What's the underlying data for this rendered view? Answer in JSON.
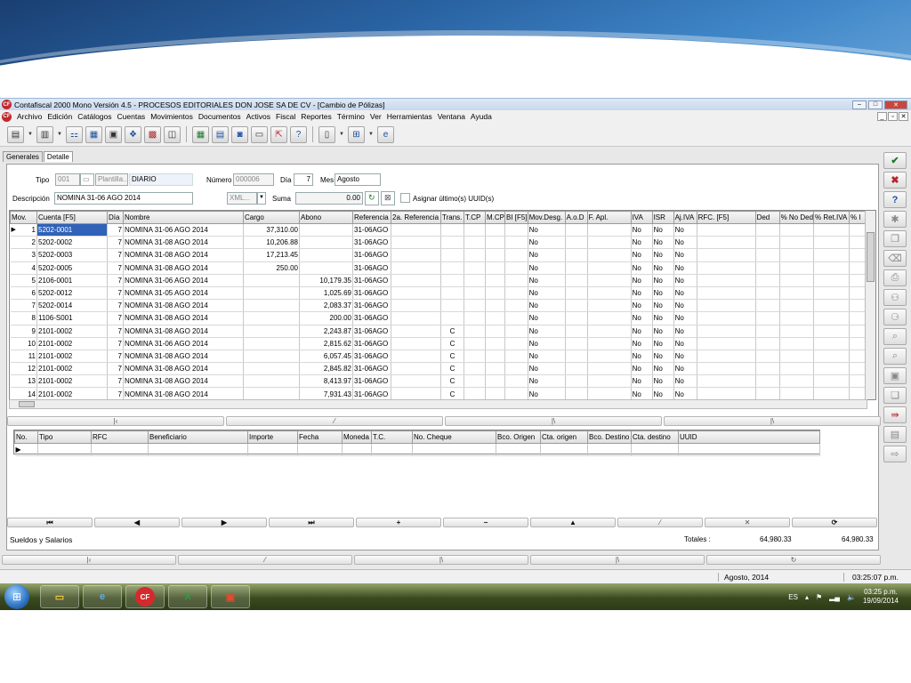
{
  "window": {
    "title": "Contafiscal 2000 Mono Versión 4.5 - PROCESOS EDITORIALES DON JOSE SA DE CV - [Cambio de Pólizas]",
    "app_logo": "CF"
  },
  "menu": [
    "Archivo",
    "Edición",
    "Catálogos",
    "Cuentas",
    "Movimientos",
    "Documentos",
    "Activos",
    "Fiscal",
    "Reportes",
    "Término",
    "Ver",
    "Herramientas",
    "Ventana",
    "Ayuda"
  ],
  "toolbar": {
    "help": "?"
  },
  "tabs": [
    "Generales",
    "Detalle"
  ],
  "form": {
    "tipo_label": "Tipo",
    "tipo_value": "001",
    "plantilla_label": "Plantilla..",
    "tipo_name": "DIARIO",
    "numero_label": "Número",
    "numero_value": "000006",
    "dia_label": "Día",
    "dia_value": "7",
    "mes_label": "Mes",
    "mes_value": "Agosto",
    "descripcion_label": "Descripción",
    "descripcion_value": "NOMINA 31-06 AGO 2014",
    "xml_label": "XML...",
    "suma_label": "Suma",
    "suma_value": "0.00",
    "asignar_label": "Asignar último(s) UUID(s)"
  },
  "grid": {
    "columns": [
      "Mov.",
      "Cuenta  [F5]",
      "Día",
      "Nombre",
      "Cargo",
      "Abono",
      "Referencia",
      "2a. Referencia",
      "Trans.",
      "T.CP",
      "M.CP",
      "BI [F5]",
      "Mov.Desg.",
      "A.o.D",
      "F. Apl.",
      "IVA",
      "ISR",
      "Aj.IVA",
      "RFC. [F5]",
      "Ded",
      "% No Ded",
      "% Ret.IVA",
      "% I"
    ],
    "rows": [
      {
        "mov": "1",
        "cuenta": "5202-0001",
        "dia": "7",
        "nombre": "NOMINA 31-06 AGO 2014",
        "cargo": "37,310.00",
        "abono": "",
        "ref": "31-06AGO",
        "trans": "",
        "desg": "No",
        "iva": "No",
        "isr": "No",
        "ajiva": "No"
      },
      {
        "mov": "2",
        "cuenta": "5202-0002",
        "dia": "7",
        "nombre": "NOMINA 31-08 AGO 2014",
        "cargo": "10,206.88",
        "abono": "",
        "ref": "31-06AGO",
        "trans": "",
        "desg": "No",
        "iva": "No",
        "isr": "No",
        "ajiva": "No"
      },
      {
        "mov": "3",
        "cuenta": "5202-0003",
        "dia": "7",
        "nombre": "NOMINA 31-08 AGO 2014",
        "cargo": "17,213.45",
        "abono": "",
        "ref": "31-06AGO",
        "trans": "",
        "desg": "No",
        "iva": "No",
        "isr": "No",
        "ajiva": "No"
      },
      {
        "mov": "4",
        "cuenta": "5202-0005",
        "dia": "7",
        "nombre": "NOMINA 31-08 AGO 2014",
        "cargo": "250.00",
        "abono": "",
        "ref": "31-06AGO",
        "trans": "",
        "desg": "No",
        "iva": "No",
        "isr": "No",
        "ajiva": "No"
      },
      {
        "mov": "5",
        "cuenta": "2106-0001",
        "dia": "7",
        "nombre": "NOMINA 31-06 AGO 2014",
        "cargo": "",
        "abono": "10,179.35",
        "ref": "31-06AGO",
        "trans": "",
        "desg": "No",
        "iva": "No",
        "isr": "No",
        "ajiva": "No"
      },
      {
        "mov": "6",
        "cuenta": "5202-0012",
        "dia": "7",
        "nombre": "NOMINA 31-05 AGO 2014",
        "cargo": "",
        "abono": "1,025.69",
        "ref": "31-06AGO",
        "trans": "",
        "desg": "No",
        "iva": "No",
        "isr": "No",
        "ajiva": "No"
      },
      {
        "mov": "7",
        "cuenta": "5202-0014",
        "dia": "7",
        "nombre": "NOMINA 31-08 AGO 2014",
        "cargo": "",
        "abono": "2,083.37",
        "ref": "31-06AGO",
        "trans": "",
        "desg": "No",
        "iva": "No",
        "isr": "No",
        "ajiva": "No"
      },
      {
        "mov": "8",
        "cuenta": "1106-S001",
        "dia": "7",
        "nombre": "NOMINA 31-08 AGO 2014",
        "cargo": "",
        "abono": "200.00",
        "ref": "31-06AGO",
        "trans": "",
        "desg": "No",
        "iva": "No",
        "isr": "No",
        "ajiva": "No"
      },
      {
        "mov": "9",
        "cuenta": "2101-0002",
        "dia": "7",
        "nombre": "NOMINA 31-08 AGO 2014",
        "cargo": "",
        "abono": "2,243.87",
        "ref": "31-06AGO",
        "trans": "C",
        "desg": "No",
        "iva": "No",
        "isr": "No",
        "ajiva": "No"
      },
      {
        "mov": "10",
        "cuenta": "2101-0002",
        "dia": "7",
        "nombre": "NOMINA 31-06 AGO 2014",
        "cargo": "",
        "abono": "2,815.62",
        "ref": "31-06AGO",
        "trans": "C",
        "desg": "No",
        "iva": "No",
        "isr": "No",
        "ajiva": "No"
      },
      {
        "mov": "11",
        "cuenta": "2101-0002",
        "dia": "7",
        "nombre": "NOMINA 31-08 AGO 2014",
        "cargo": "",
        "abono": "6,057.45",
        "ref": "31-06AGO",
        "trans": "C",
        "desg": "No",
        "iva": "No",
        "isr": "No",
        "ajiva": "No"
      },
      {
        "mov": "12",
        "cuenta": "2101-0002",
        "dia": "7",
        "nombre": "NOMINA 31-08 AGO 2014",
        "cargo": "",
        "abono": "2,845.82",
        "ref": "31-06AGO",
        "trans": "C",
        "desg": "No",
        "iva": "No",
        "isr": "No",
        "ajiva": "No"
      },
      {
        "mov": "13",
        "cuenta": "2101-0002",
        "dia": "7",
        "nombre": "NOMINA 31-08 AGO 2014",
        "cargo": "",
        "abono": "8,413.97",
        "ref": "31-06AGO",
        "trans": "C",
        "desg": "No",
        "iva": "No",
        "isr": "No",
        "ajiva": "No"
      },
      {
        "mov": "14",
        "cuenta": "2101-0002",
        "dia": "7",
        "nombre": "NOMINA 31-08 AGO 2014",
        "cargo": "",
        "abono": "7,931.43",
        "ref": "31-06AGO",
        "trans": "C",
        "desg": "No",
        "iva": "No",
        "isr": "No",
        "ajiva": "No"
      }
    ]
  },
  "grid2": {
    "columns": [
      "No.",
      "Tipo",
      "RFC",
      "Beneficiario",
      "Importe",
      "Fecha",
      "Moneda",
      "T.C.",
      "No. Cheque",
      "Bco. Origen",
      "Cta. origen",
      "Bco. Destino",
      "Cta. destino",
      "UUID"
    ]
  },
  "nav": {
    "first": "⏮",
    "prev": "◀",
    "next": "▶",
    "last": "⏭",
    "add": "+",
    "remove": "−",
    "up": "▲",
    "refresh": "⟳"
  },
  "footer": {
    "label": "Sueldos y Salarios",
    "totales_label": "Totales :",
    "total_cargo": "64,980.33",
    "total_abono": "64,980.33"
  },
  "statusbar": {
    "period": "Agosto, 2014",
    "time": "03:25:07 p.m."
  },
  "taskbar": {
    "lang": "ES",
    "clock_time": "03:25 p.m.",
    "clock_date": "19/09/2014",
    "apps": [
      "explorer",
      "ie",
      "contafiscal",
      "excel",
      "acrobat"
    ]
  },
  "colors": {
    "selection": "#2f62b8",
    "ok": "#1c7a2c",
    "cancel": "#b4262b",
    "help": "#1b4f9c"
  }
}
